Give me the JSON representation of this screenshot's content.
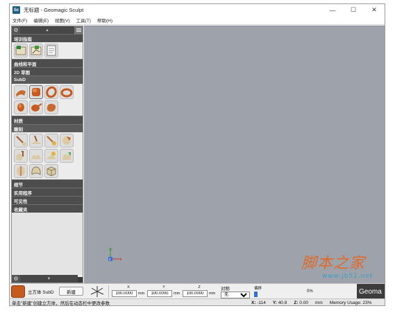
{
  "window": {
    "title": "无标题 - Geomagic Sculpt",
    "app_icon": "Sc"
  },
  "menu": [
    "文件(F)",
    "编辑(E)",
    "视图(V)",
    "工具(T)",
    "帮助(H)"
  ],
  "sidebar": {
    "categories": {
      "tutorial": "培训指南",
      "curves": "曲线和平面",
      "twod": "2D 草图",
      "subd": "SubD",
      "materials": "材质",
      "sculpt": "雕刻",
      "detail": "细节",
      "utilities": "实用程序",
      "visibility": "可见性",
      "favorites": "收藏夹"
    }
  },
  "bottombar": {
    "primitive_label": "立方体 SubD",
    "new_button": "新建",
    "x_label": "X",
    "y_label": "Y",
    "z_label": "Z",
    "x_value": "100.0000",
    "y_value": "100.0000",
    "z_value": "100.0000",
    "unit": "mm",
    "symmetry_label": "对称",
    "symmetry_value": "无",
    "slider_label": "偏移",
    "slider_percent": "0%",
    "slider_level": 0,
    "brand": "Geoma"
  },
  "status": {
    "message": "单击\"新建\"创建立方体，然后在动态栏中更改参数",
    "x_label": "X:",
    "x_value": "-114",
    "y_label": "Y:",
    "y_value": "40.8",
    "z_label": "Z:",
    "z_value": "0.00",
    "unit": "mm",
    "memory": "Memory Usage: 23%"
  },
  "watermark": {
    "text": "脚本之家",
    "url": "www.jb51.net"
  },
  "colors": {
    "viewport": "#9ea3ab",
    "category_bar": "#4d4d4d",
    "accent": "#c75b1f"
  }
}
